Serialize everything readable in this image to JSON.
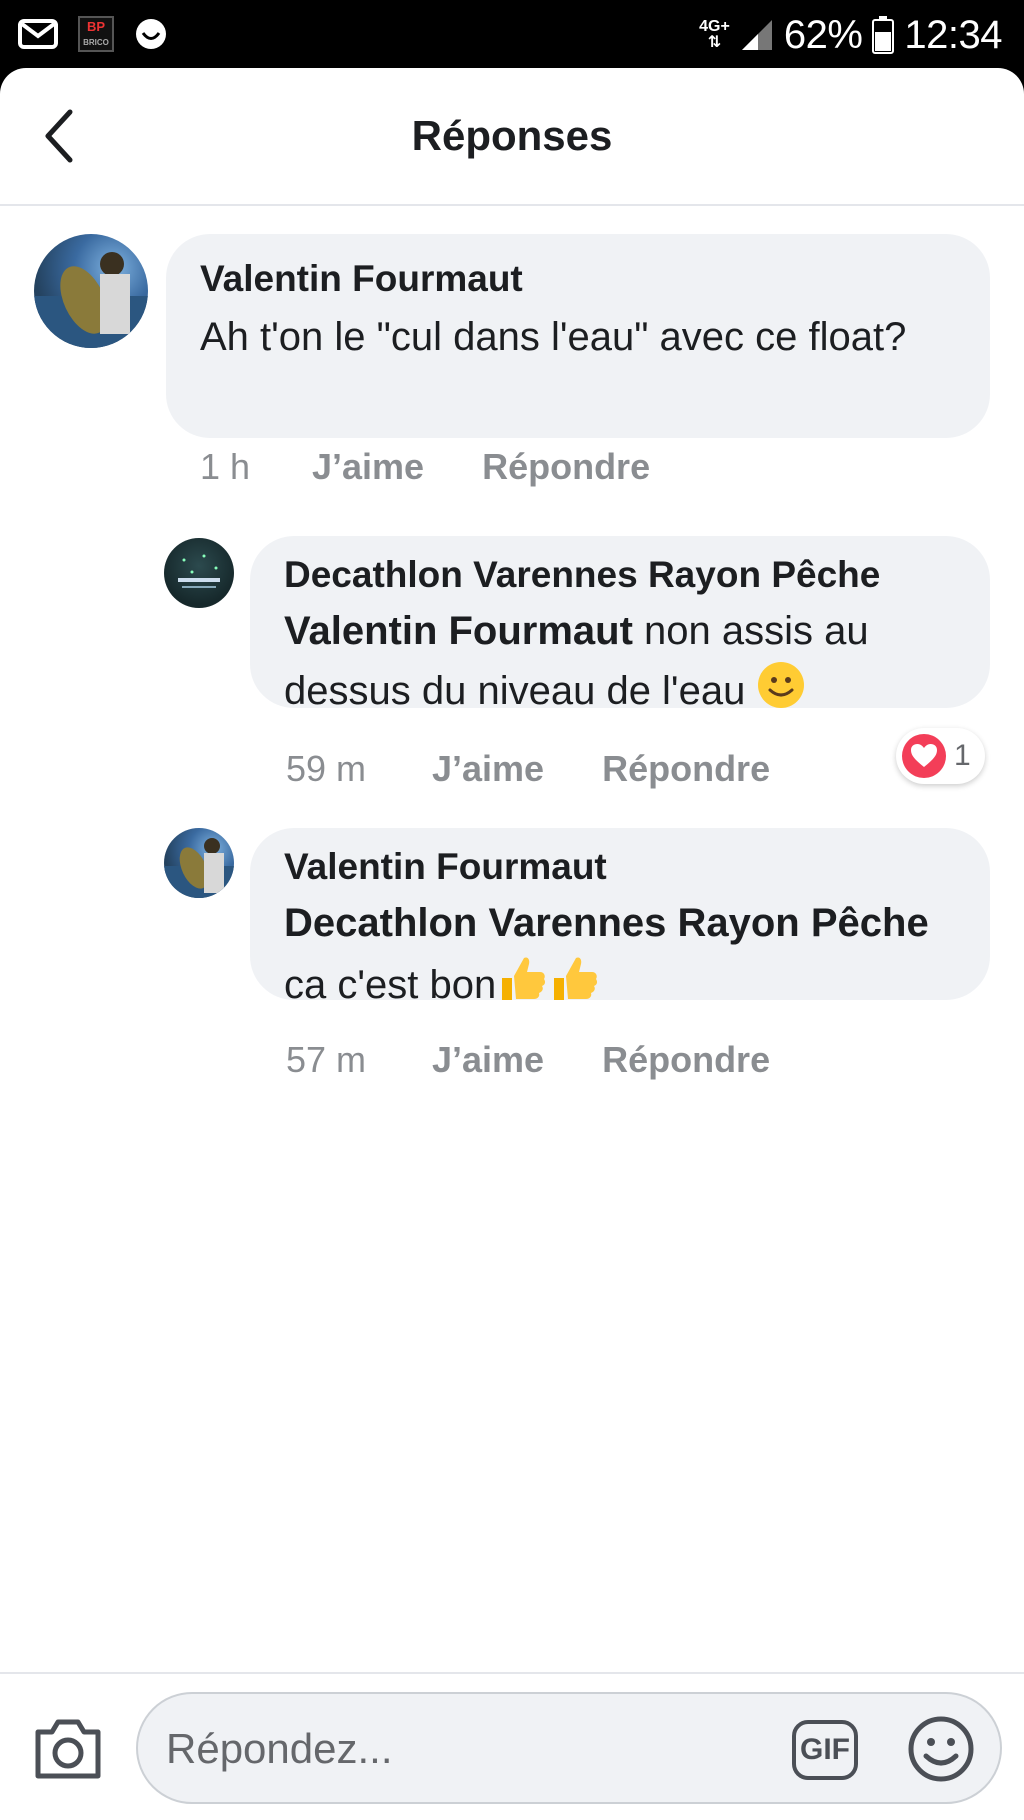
{
  "status_bar": {
    "network": "4G+",
    "battery": "62%",
    "time": "12:34",
    "notification_icons": [
      "mail-icon",
      "app-logo-icon",
      "smiley-notification-icon"
    ]
  },
  "header": {
    "title": "Réponses",
    "back_icon": "chevron-left-icon"
  },
  "comments": [
    {
      "author": "Valentin Fourmaut",
      "mention": "",
      "text": "Ah t'on le \"cul dans l'eau\" avec ce float?",
      "time": "1 h",
      "like": "J’aime",
      "reply": "Répondre"
    },
    {
      "author": "Decathlon Varennes Rayon Pêche",
      "mention": "Valentin Fourmaut",
      "text": " non assis au dessus du niveau de l'eau ",
      "emoji": "slightly-smiling-face",
      "time": "59 m",
      "like": "J’aime",
      "reply": "Répondre",
      "reaction": {
        "type": "love",
        "count": "1",
        "color": "#f33e58"
      }
    },
    {
      "author": "Valentin Fourmaut",
      "mention": "Decathlon Varennes Rayon Pêche",
      "text": " ca c'est bon",
      "emoji": "thumbs-up x2",
      "time": "57 m",
      "like": "J’aime",
      "reply": "Répondre"
    }
  ],
  "composer": {
    "placeholder": "Répondez...",
    "gif_label": "GIF",
    "camera_icon": "camera-icon",
    "emoji_icon": "smiley-icon"
  },
  "colors": {
    "bubble": "#f0f2f5",
    "text": "#1c1e21",
    "meta": "#8a8d91",
    "love": "#f33e58"
  }
}
